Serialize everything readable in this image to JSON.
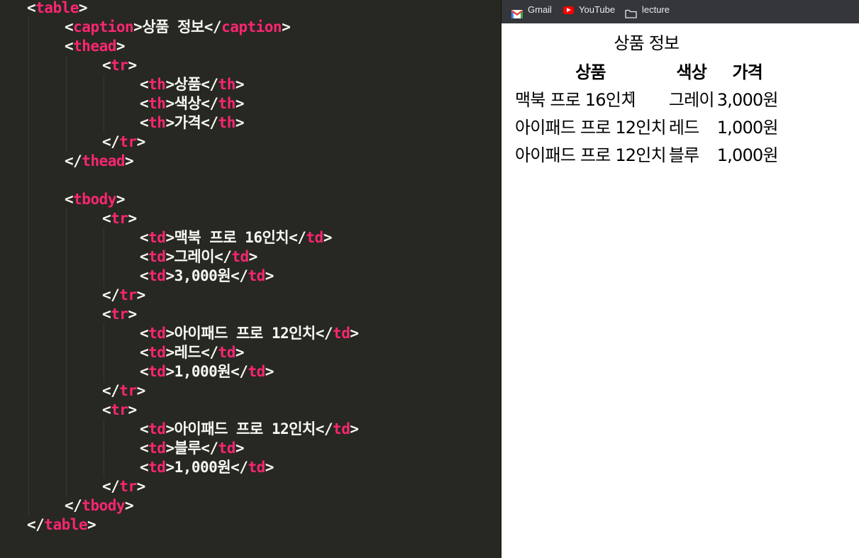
{
  "editor": {
    "lines": [
      {
        "indent": 0,
        "tokens": [
          {
            "t": "punc",
            "v": "<"
          },
          {
            "t": "tag",
            "v": "table"
          },
          {
            "t": "punc",
            "v": ">"
          }
        ]
      },
      {
        "indent": 1,
        "tokens": [
          {
            "t": "punc",
            "v": "<"
          },
          {
            "t": "tag",
            "v": "caption"
          },
          {
            "t": "punc",
            "v": ">"
          },
          {
            "t": "txt",
            "v": "상품 정보"
          },
          {
            "t": "punc",
            "v": "</"
          },
          {
            "t": "tag",
            "v": "caption"
          },
          {
            "t": "punc",
            "v": ">"
          }
        ]
      },
      {
        "indent": 1,
        "tokens": [
          {
            "t": "punc",
            "v": "<"
          },
          {
            "t": "tag",
            "v": "thead"
          },
          {
            "t": "punc",
            "v": ">"
          }
        ]
      },
      {
        "indent": 2,
        "tokens": [
          {
            "t": "punc",
            "v": "<"
          },
          {
            "t": "tag",
            "v": "tr"
          },
          {
            "t": "punc",
            "v": ">"
          }
        ]
      },
      {
        "indent": 3,
        "tokens": [
          {
            "t": "punc",
            "v": "<"
          },
          {
            "t": "tag",
            "v": "th"
          },
          {
            "t": "punc",
            "v": ">"
          },
          {
            "t": "txt",
            "v": "상품"
          },
          {
            "t": "punc",
            "v": "</"
          },
          {
            "t": "tag",
            "v": "th"
          },
          {
            "t": "punc",
            "v": ">"
          }
        ]
      },
      {
        "indent": 3,
        "tokens": [
          {
            "t": "punc",
            "v": "<"
          },
          {
            "t": "tag",
            "v": "th"
          },
          {
            "t": "punc",
            "v": ">"
          },
          {
            "t": "txt",
            "v": "색상"
          },
          {
            "t": "punc",
            "v": "</"
          },
          {
            "t": "tag",
            "v": "th"
          },
          {
            "t": "punc",
            "v": ">"
          }
        ]
      },
      {
        "indent": 3,
        "tokens": [
          {
            "t": "punc",
            "v": "<"
          },
          {
            "t": "tag",
            "v": "th"
          },
          {
            "t": "punc",
            "v": ">"
          },
          {
            "t": "txt",
            "v": "가격"
          },
          {
            "t": "punc",
            "v": "</"
          },
          {
            "t": "tag",
            "v": "th"
          },
          {
            "t": "punc",
            "v": ">"
          }
        ]
      },
      {
        "indent": 2,
        "tokens": [
          {
            "t": "punc",
            "v": "</"
          },
          {
            "t": "tag",
            "v": "tr"
          },
          {
            "t": "punc",
            "v": ">"
          }
        ]
      },
      {
        "indent": 1,
        "tokens": [
          {
            "t": "punc",
            "v": "</"
          },
          {
            "t": "tag",
            "v": "thead"
          },
          {
            "t": "punc",
            "v": ">"
          }
        ]
      },
      {
        "indent": 0,
        "tokens": []
      },
      {
        "indent": 1,
        "tokens": [
          {
            "t": "punc",
            "v": "<"
          },
          {
            "t": "tag",
            "v": "tbody"
          },
          {
            "t": "punc",
            "v": ">"
          }
        ]
      },
      {
        "indent": 2,
        "tokens": [
          {
            "t": "punc",
            "v": "<"
          },
          {
            "t": "tag",
            "v": "tr"
          },
          {
            "t": "punc",
            "v": ">"
          }
        ]
      },
      {
        "indent": 3,
        "tokens": [
          {
            "t": "punc",
            "v": "<"
          },
          {
            "t": "tag",
            "v": "td"
          },
          {
            "t": "punc",
            "v": ">"
          },
          {
            "t": "txt",
            "v": "맥북 프로 16인치"
          },
          {
            "t": "punc",
            "v": "</"
          },
          {
            "t": "tag",
            "v": "td"
          },
          {
            "t": "punc",
            "v": ">"
          }
        ]
      },
      {
        "indent": 3,
        "tokens": [
          {
            "t": "punc",
            "v": "<"
          },
          {
            "t": "tag",
            "v": "td"
          },
          {
            "t": "punc",
            "v": ">"
          },
          {
            "t": "txt",
            "v": "그레이"
          },
          {
            "t": "punc",
            "v": "</"
          },
          {
            "t": "tag",
            "v": "td"
          },
          {
            "t": "punc",
            "v": ">"
          }
        ]
      },
      {
        "indent": 3,
        "tokens": [
          {
            "t": "punc",
            "v": "<"
          },
          {
            "t": "tag",
            "v": "td"
          },
          {
            "t": "punc",
            "v": ">"
          },
          {
            "t": "txt",
            "v": "3,000원"
          },
          {
            "t": "punc",
            "v": "</"
          },
          {
            "t": "tag",
            "v": "td"
          },
          {
            "t": "punc",
            "v": ">"
          }
        ]
      },
      {
        "indent": 2,
        "tokens": [
          {
            "t": "punc",
            "v": "</"
          },
          {
            "t": "tag",
            "v": "tr"
          },
          {
            "t": "punc",
            "v": ">"
          }
        ]
      },
      {
        "indent": 2,
        "tokens": [
          {
            "t": "punc",
            "v": "<"
          },
          {
            "t": "tag",
            "v": "tr"
          },
          {
            "t": "punc",
            "v": ">"
          }
        ]
      },
      {
        "indent": 3,
        "tokens": [
          {
            "t": "punc",
            "v": "<"
          },
          {
            "t": "tag",
            "v": "td"
          },
          {
            "t": "punc",
            "v": ">"
          },
          {
            "t": "txt",
            "v": "아이패드 프로 12인치"
          },
          {
            "t": "punc",
            "v": "</"
          },
          {
            "t": "tag",
            "v": "td"
          },
          {
            "t": "punc",
            "v": ">"
          }
        ]
      },
      {
        "indent": 3,
        "tokens": [
          {
            "t": "punc",
            "v": "<"
          },
          {
            "t": "tag",
            "v": "td"
          },
          {
            "t": "punc",
            "v": ">"
          },
          {
            "t": "txt",
            "v": "레드"
          },
          {
            "t": "punc",
            "v": "</"
          },
          {
            "t": "tag",
            "v": "td"
          },
          {
            "t": "punc",
            "v": ">"
          }
        ]
      },
      {
        "indent": 3,
        "tokens": [
          {
            "t": "punc",
            "v": "<"
          },
          {
            "t": "tag",
            "v": "td"
          },
          {
            "t": "punc",
            "v": ">"
          },
          {
            "t": "txt",
            "v": "1,000원"
          },
          {
            "t": "punc",
            "v": "</"
          },
          {
            "t": "tag",
            "v": "td"
          },
          {
            "t": "punc",
            "v": ">"
          }
        ]
      },
      {
        "indent": 2,
        "tokens": [
          {
            "t": "punc",
            "v": "</"
          },
          {
            "t": "tag",
            "v": "tr"
          },
          {
            "t": "punc",
            "v": ">"
          }
        ]
      },
      {
        "indent": 2,
        "tokens": [
          {
            "t": "punc",
            "v": "<"
          },
          {
            "t": "tag",
            "v": "tr"
          },
          {
            "t": "punc",
            "v": ">"
          }
        ]
      },
      {
        "indent": 3,
        "tokens": [
          {
            "t": "punc",
            "v": "<"
          },
          {
            "t": "tag",
            "v": "td"
          },
          {
            "t": "punc",
            "v": ">"
          },
          {
            "t": "txt",
            "v": "아이패드 프로 12인치"
          },
          {
            "t": "punc",
            "v": "</"
          },
          {
            "t": "tag",
            "v": "td"
          },
          {
            "t": "punc",
            "v": ">"
          }
        ]
      },
      {
        "indent": 3,
        "tokens": [
          {
            "t": "punc",
            "v": "<"
          },
          {
            "t": "tag",
            "v": "td"
          },
          {
            "t": "punc",
            "v": ">"
          },
          {
            "t": "txt",
            "v": "블루"
          },
          {
            "t": "punc",
            "v": "</"
          },
          {
            "t": "tag",
            "v": "td"
          },
          {
            "t": "punc",
            "v": ">"
          }
        ]
      },
      {
        "indent": 3,
        "tokens": [
          {
            "t": "punc",
            "v": "<"
          },
          {
            "t": "tag",
            "v": "td"
          },
          {
            "t": "punc",
            "v": ">"
          },
          {
            "t": "txt",
            "v": "1,000원"
          },
          {
            "t": "punc",
            "v": "</"
          },
          {
            "t": "tag",
            "v": "td"
          },
          {
            "t": "punc",
            "v": ">"
          }
        ]
      },
      {
        "indent": 2,
        "tokens": [
          {
            "t": "punc",
            "v": "</"
          },
          {
            "t": "tag",
            "v": "tr"
          },
          {
            "t": "punc",
            "v": ">"
          }
        ]
      },
      {
        "indent": 1,
        "tokens": [
          {
            "t": "punc",
            "v": "</"
          },
          {
            "t": "tag",
            "v": "tbody"
          },
          {
            "t": "punc",
            "v": ">"
          }
        ]
      },
      {
        "indent": 0,
        "tokens": [
          {
            "t": "punc",
            "v": "</"
          },
          {
            "t": "tag",
            "v": "table"
          },
          {
            "t": "punc",
            "v": ">"
          }
        ]
      }
    ],
    "colors": {
      "background": "#272822",
      "tag": "#f92672",
      "text": "#f8f8f2"
    }
  },
  "browser": {
    "bookmarks": [
      {
        "label": "Gmail",
        "icon": "gmail-icon"
      },
      {
        "label": "YouTube",
        "icon": "youtube-icon"
      },
      {
        "label": "lecture",
        "icon": "folder-icon"
      }
    ],
    "page": {
      "table": {
        "caption": "상품 정보",
        "headers": [
          "상품",
          "색상",
          "가격"
        ],
        "rows": [
          [
            "맥북 프로 16인치",
            "그레이",
            "3,000원"
          ],
          [
            "아이패드 프로 12인치",
            "레드",
            "1,000원"
          ],
          [
            "아이패드 프로 12인치",
            "블루",
            "1,000원"
          ]
        ]
      }
    }
  }
}
